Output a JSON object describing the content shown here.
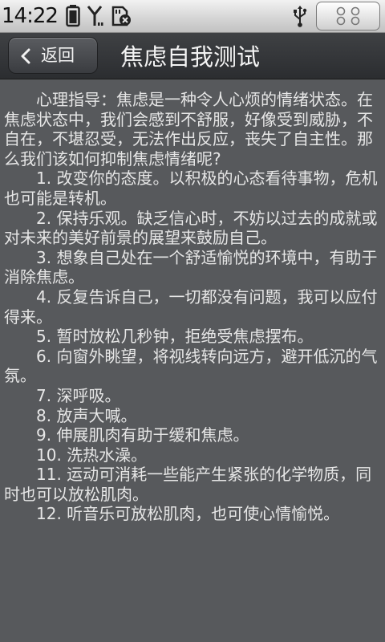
{
  "status_bar": {
    "time": "14:22",
    "icons": [
      "battery-icon",
      "signal-icon",
      "sd-card-error-icon",
      "usb-icon",
      "menu-grid-icon"
    ]
  },
  "header": {
    "back_label": "返回",
    "title": "焦虑自我测试"
  },
  "content": {
    "paragraphs": [
      "心理指导：焦虑是一种令人心烦的情绪状态。在焦虑状态中，我们会感到不舒服，好像受到威胁，不自在，不堪忍受，无法作出反应，丧失了自主性。那么我们该如何抑制焦虑情绪呢?",
      "1. 改变你的态度。以积极的心态看待事物，危机也可能是转机。",
      "2. 保持乐观。缺乏信心时，不妨以过去的成就或对未来的美好前景的展望来鼓励自己。",
      "3. 想象自己处在一个舒适愉悦的环境中，有助于消除焦虑。",
      "4. 反复告诉自己，一切都没有问题，我可以应付得来。",
      "5. 暂时放松几秒钟，拒绝受焦虑摆布。",
      "6. 向窗外眺望，将视线转向远方，避开低沉的气氛。",
      "7. 深呼吸。",
      "8. 放声大喊。",
      "9. 伸展肌肉有助于缓和焦虑。",
      "10. 洗热水澡。",
      "11. 运动可消耗一些能产生紧张的化学物质，同时也可以放松肌肉。",
      "12. 听音乐可放松肌肉，也可使心情愉悦。"
    ]
  },
  "colors": {
    "content_bg": "#57595c",
    "text": "#e6e6e6",
    "titlebar_bg": "#2f3134"
  }
}
